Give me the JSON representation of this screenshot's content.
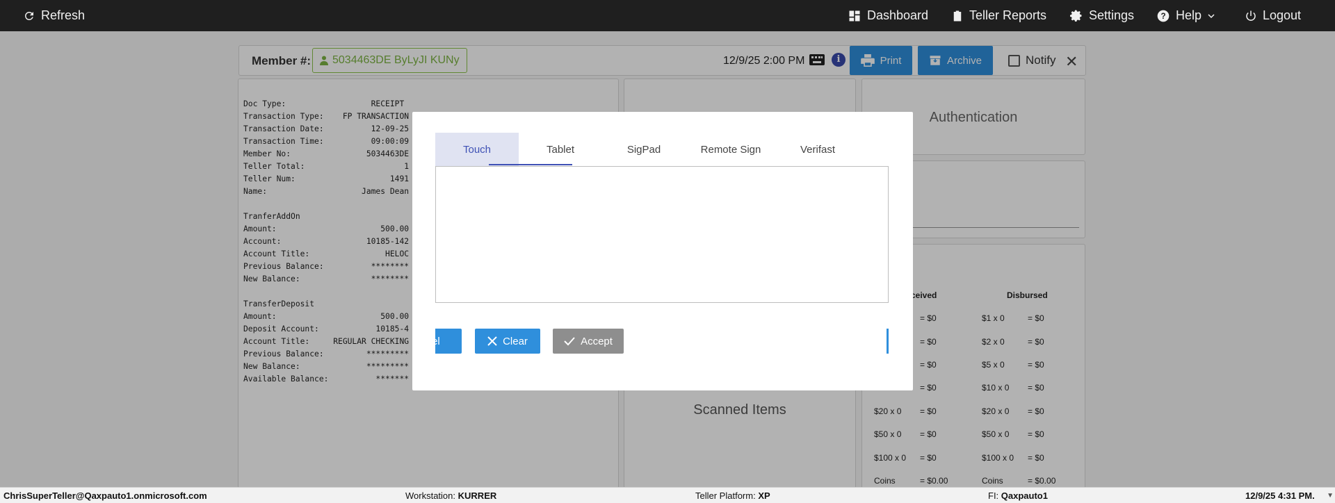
{
  "topbar": {
    "refresh": "Refresh",
    "dashboard": "Dashboard",
    "teller_reports": "Teller Reports",
    "settings": "Settings",
    "help": "Help",
    "logout": "Logout"
  },
  "member": {
    "label": "Member #:",
    "chip": "5034463DE ByLyJI KUNy",
    "datetime": "12/9/25 2:00 PM",
    "print": "Print",
    "archive": "Archive",
    "notify": "Notify",
    "close": "✕"
  },
  "receipt": {
    "lines": [
      "Doc Type:                  RECEIPT",
      "Transaction Type:    FP TRANSACTION",
      "Transaction Date:          12-09-25",
      "Transaction Time:          09:00:09",
      "Member No:                5034463DE",
      "Teller Total:                     1",
      "Teller Num:                    1491",
      "Name:                    James Dean",
      "",
      "TranferAddOn",
      "Amount:                      500.00",
      "Account:                  10185-142",
      "Account Title:                HELOC",
      "Previous Balance:          ********",
      "New Balance:               ********",
      "",
      "TransferDeposit",
      "Amount:                      500.00",
      "Deposit Account:            10185-4",
      "Account Title:     REGULAR CHECKING",
      "Previous Balance:         *********",
      "New Balance:              *********",
      "Available Balance:          *******"
    ]
  },
  "panels": {
    "scanned_items": "Scanned Items",
    "authentication": "Authentication"
  },
  "cash": {
    "received_header": "ceived",
    "disbursed_header": "Disbursed",
    "received_rows": [
      {
        "denom": "",
        "amt": "= $0"
      },
      {
        "denom": "",
        "amt": "= $0"
      },
      {
        "denom": "",
        "amt": "= $0"
      },
      {
        "denom": "",
        "amt": "= $0"
      },
      {
        "denom": "$20 x 0",
        "amt": "= $0"
      },
      {
        "denom": "$50 x 0",
        "amt": "= $0"
      },
      {
        "denom": "$100 x 0",
        "amt": "= $0"
      },
      {
        "denom": "Coins",
        "amt": "= $0.00"
      }
    ],
    "disbursed_rows": [
      {
        "denom": "$1 x 0",
        "amt": "= $0"
      },
      {
        "denom": "$2 x 0",
        "amt": "= $0"
      },
      {
        "denom": "$5 x 0",
        "amt": "= $0"
      },
      {
        "denom": "$10 x 0",
        "amt": "= $0"
      },
      {
        "denom": "$20 x 0",
        "amt": "= $0"
      },
      {
        "denom": "$50 x 0",
        "amt": "= $0"
      },
      {
        "denom": "$100 x 0",
        "amt": "= $0"
      },
      {
        "denom": "Coins",
        "amt": "= $0.00"
      }
    ]
  },
  "modal": {
    "tabs": [
      "Touch",
      "Tablet",
      "SigPad",
      "Remote Sign",
      "Verifast"
    ],
    "active_tab": "Touch",
    "cancel": "ncel",
    "clear": "Clear",
    "accept": "Accept"
  },
  "status": {
    "user": "ChrisSuperTeller@Qaxpauto1.onmicrosoft.com",
    "workstation_label": "Workstation:",
    "workstation": "KURRER",
    "platform_label": "Teller Platform:",
    "platform": "XP",
    "fi_label": "FI:",
    "fi": "Qaxpauto1",
    "datetime": "12/9/25 4:31 PM."
  },
  "colors": {
    "accent_blue": "#2f8fdc",
    "member_green": "#7cb342",
    "tab_indigo": "#3f51b5",
    "topbar": "#1f1f1f"
  }
}
